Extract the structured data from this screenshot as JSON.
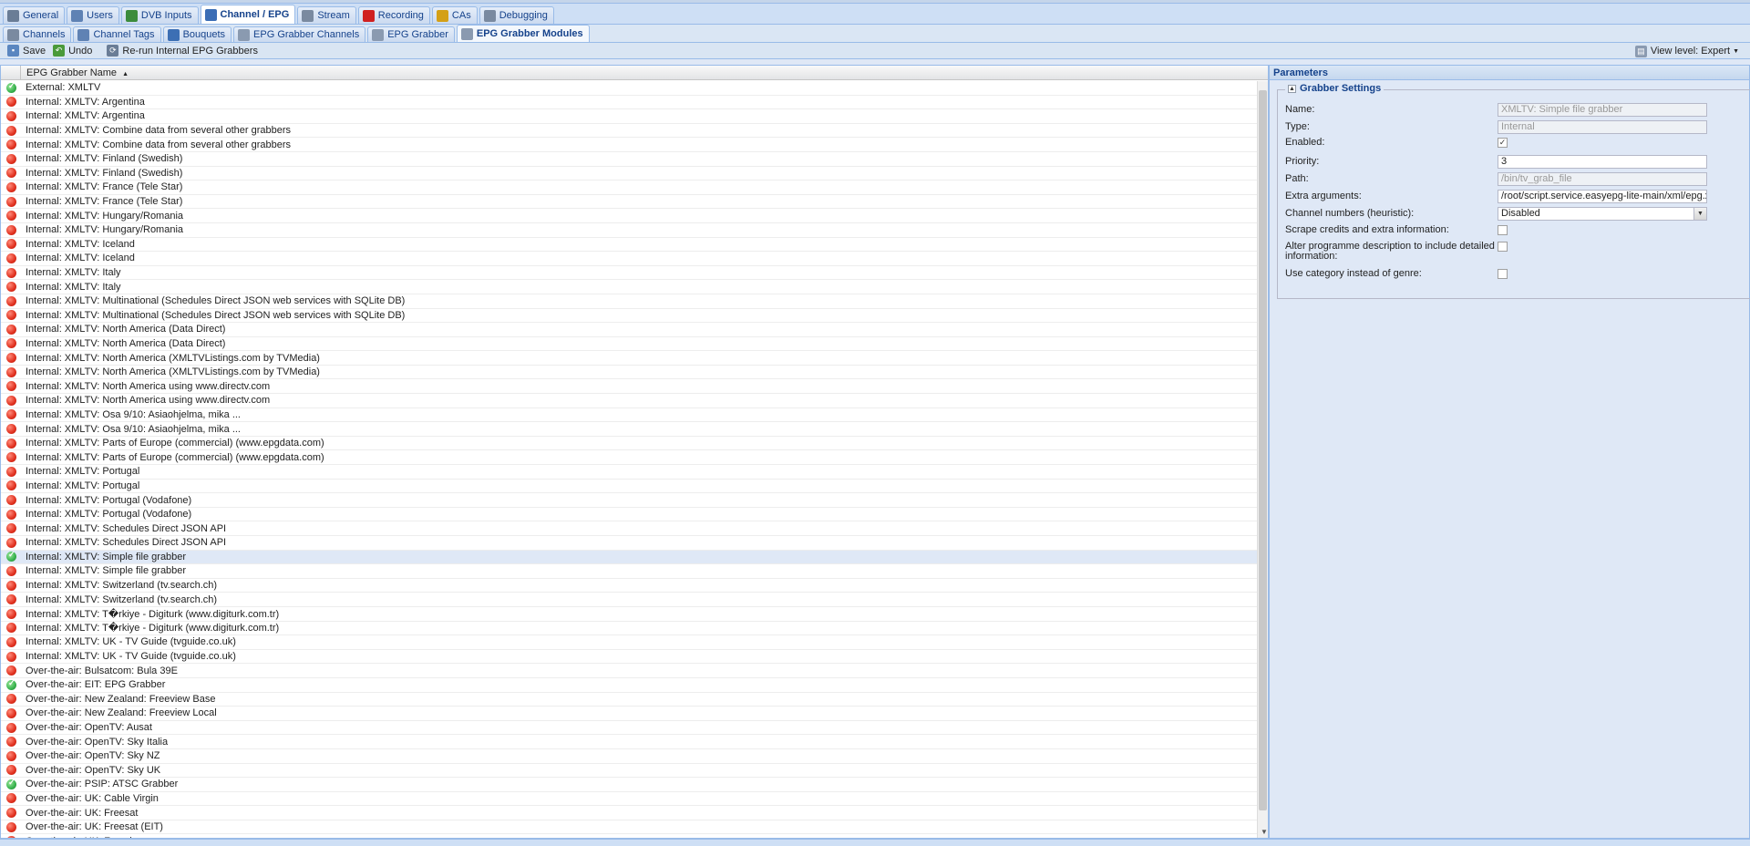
{
  "main_tabs": [
    {
      "label": "General",
      "icon": "wrench-icon",
      "color": "#6a7d96"
    },
    {
      "label": "Users",
      "icon": "users-icon",
      "color": "#5f82b4"
    },
    {
      "label": "DVB Inputs",
      "icon": "dvb-card-icon",
      "color": "#3c8c3c"
    },
    {
      "label": "Channel / EPG",
      "icon": "tv-icon",
      "color": "#3b6db5",
      "active": true
    },
    {
      "label": "Stream",
      "icon": "stream-icon",
      "color": "#7a8aa0"
    },
    {
      "label": "Recording",
      "icon": "rec-icon",
      "color": "#d02020"
    },
    {
      "label": "CAs",
      "icon": "key-icon",
      "color": "#d4a017"
    },
    {
      "label": "Debugging",
      "icon": "bug-icon",
      "color": "#7a8aa0"
    }
  ],
  "sub_tabs": [
    {
      "label": "Channels",
      "icon": "channels-icon",
      "color": "#7a8aa0"
    },
    {
      "label": "Channel Tags",
      "icon": "tag-icon",
      "color": "#5f82b4"
    },
    {
      "label": "Bouquets",
      "icon": "bouquet-icon",
      "color": "#3c6fb4"
    },
    {
      "label": "EPG Grabber Channels",
      "icon": "epg-channels-icon",
      "color": "#8a9ab0"
    },
    {
      "label": "EPG Grabber",
      "icon": "epg-grabber-icon",
      "color": "#8a9ab0"
    },
    {
      "label": "EPG Grabber Modules",
      "icon": "epg-modules-icon",
      "color": "#8a9ab0",
      "active": true
    }
  ],
  "toolbar": {
    "save": "Save",
    "undo": "Undo",
    "rerun": "Re-run Internal EPG Grabbers",
    "view_level": "View level: Expert"
  },
  "grid": {
    "column": "EPG Grabber Name",
    "rows": [
      {
        "name": "External: XMLTV",
        "enabled": true
      },
      {
        "name": "Internal: XMLTV: Argentina",
        "enabled": false
      },
      {
        "name": "Internal: XMLTV: Argentina",
        "enabled": false
      },
      {
        "name": "Internal: XMLTV: Combine data from several other grabbers",
        "enabled": false
      },
      {
        "name": "Internal: XMLTV: Combine data from several other grabbers",
        "enabled": false
      },
      {
        "name": "Internal: XMLTV: Finland (Swedish)",
        "enabled": false
      },
      {
        "name": "Internal: XMLTV: Finland (Swedish)",
        "enabled": false
      },
      {
        "name": "Internal: XMLTV: France (Tele Star)",
        "enabled": false
      },
      {
        "name": "Internal: XMLTV: France (Tele Star)",
        "enabled": false
      },
      {
        "name": "Internal: XMLTV: Hungary/Romania",
        "enabled": false
      },
      {
        "name": "Internal: XMLTV: Hungary/Romania",
        "enabled": false
      },
      {
        "name": "Internal: XMLTV: Iceland",
        "enabled": false
      },
      {
        "name": "Internal: XMLTV: Iceland",
        "enabled": false
      },
      {
        "name": "Internal: XMLTV: Italy",
        "enabled": false
      },
      {
        "name": "Internal: XMLTV: Italy",
        "enabled": false
      },
      {
        "name": "Internal: XMLTV: Multinational (Schedules Direct JSON web services with SQLite DB)",
        "enabled": false
      },
      {
        "name": "Internal: XMLTV: Multinational (Schedules Direct JSON web services with SQLite DB)",
        "enabled": false
      },
      {
        "name": "Internal: XMLTV: North America (Data Direct)",
        "enabled": false
      },
      {
        "name": "Internal: XMLTV: North America (Data Direct)",
        "enabled": false
      },
      {
        "name": "Internal: XMLTV: North America (XMLTVListings.com by TVMedia)",
        "enabled": false
      },
      {
        "name": "Internal: XMLTV: North America (XMLTVListings.com by TVMedia)",
        "enabled": false
      },
      {
        "name": "Internal: XMLTV: North America using www.directv.com",
        "enabled": false
      },
      {
        "name": "Internal: XMLTV: North America using www.directv.com",
        "enabled": false
      },
      {
        "name": "Internal: XMLTV: Osa 9/10: Asiaohjelma, mika ...",
        "enabled": false
      },
      {
        "name": "Internal: XMLTV: Osa 9/10: Asiaohjelma, mika ...",
        "enabled": false
      },
      {
        "name": "Internal: XMLTV: Parts of Europe (commercial) (www.epgdata.com)",
        "enabled": false
      },
      {
        "name": "Internal: XMLTV: Parts of Europe (commercial) (www.epgdata.com)",
        "enabled": false
      },
      {
        "name": "Internal: XMLTV: Portugal",
        "enabled": false
      },
      {
        "name": "Internal: XMLTV: Portugal",
        "enabled": false
      },
      {
        "name": "Internal: XMLTV: Portugal (Vodafone)",
        "enabled": false
      },
      {
        "name": "Internal: XMLTV: Portugal (Vodafone)",
        "enabled": false
      },
      {
        "name": "Internal: XMLTV: Schedules Direct JSON API",
        "enabled": false
      },
      {
        "name": "Internal: XMLTV: Schedules Direct JSON API",
        "enabled": false
      },
      {
        "name": "Internal: XMLTV: Simple file grabber",
        "enabled": true,
        "selected": true
      },
      {
        "name": "Internal: XMLTV: Simple file grabber",
        "enabled": false
      },
      {
        "name": "Internal: XMLTV: Switzerland (tv.search.ch)",
        "enabled": false
      },
      {
        "name": "Internal: XMLTV: Switzerland (tv.search.ch)",
        "enabled": false
      },
      {
        "name": "Internal: XMLTV: T�rkiye - Digiturk (www.digiturk.com.tr)",
        "enabled": false
      },
      {
        "name": "Internal: XMLTV: T�rkiye - Digiturk (www.digiturk.com.tr)",
        "enabled": false
      },
      {
        "name": "Internal: XMLTV: UK - TV Guide (tvguide.co.uk)",
        "enabled": false
      },
      {
        "name": "Internal: XMLTV: UK - TV Guide (tvguide.co.uk)",
        "enabled": false
      },
      {
        "name": "Over-the-air: Bulsatcom: Bula 39E",
        "enabled": false
      },
      {
        "name": "Over-the-air: EIT: EPG Grabber",
        "enabled": true
      },
      {
        "name": "Over-the-air: New Zealand: Freeview Base",
        "enabled": false
      },
      {
        "name": "Over-the-air: New Zealand: Freeview Local",
        "enabled": false
      },
      {
        "name": "Over-the-air: OpenTV: Ausat",
        "enabled": false
      },
      {
        "name": "Over-the-air: OpenTV: Sky Italia",
        "enabled": false
      },
      {
        "name": "Over-the-air: OpenTV: Sky NZ",
        "enabled": false
      },
      {
        "name": "Over-the-air: OpenTV: Sky UK",
        "enabled": false
      },
      {
        "name": "Over-the-air: PSIP: ATSC Grabber",
        "enabled": true
      },
      {
        "name": "Over-the-air: UK: Cable Virgin",
        "enabled": false
      },
      {
        "name": "Over-the-air: UK: Freesat",
        "enabled": false
      },
      {
        "name": "Over-the-air: UK: Freesat (EIT)",
        "enabled": false
      },
      {
        "name": "Over-the-air: UK: Freeview",
        "enabled": false
      }
    ]
  },
  "parameters": {
    "title": "Parameters",
    "section": "Grabber Settings",
    "fields": {
      "name": {
        "label": "Name:",
        "value": "XMLTV: Simple file grabber"
      },
      "type": {
        "label": "Type:",
        "value": "Internal"
      },
      "enabled": {
        "label": "Enabled:",
        "checked": true
      },
      "priority": {
        "label": "Priority:",
        "value": "3"
      },
      "path": {
        "label": "Path:",
        "value": "/bin/tv_grab_file"
      },
      "extra_args": {
        "label": "Extra arguments:",
        "value": "/root/script.service.easyepg-lite-main/xml/epg.xml"
      },
      "channel_numbers": {
        "label": "Channel numbers (heuristic):",
        "value": "Disabled"
      },
      "scrape_credits": {
        "label": "Scrape credits and extra information:",
        "checked": false
      },
      "alter_description": {
        "label": "Alter programme description to include detailed information:",
        "checked": false
      },
      "use_category": {
        "label": "Use category instead of genre:",
        "checked": false
      }
    }
  }
}
